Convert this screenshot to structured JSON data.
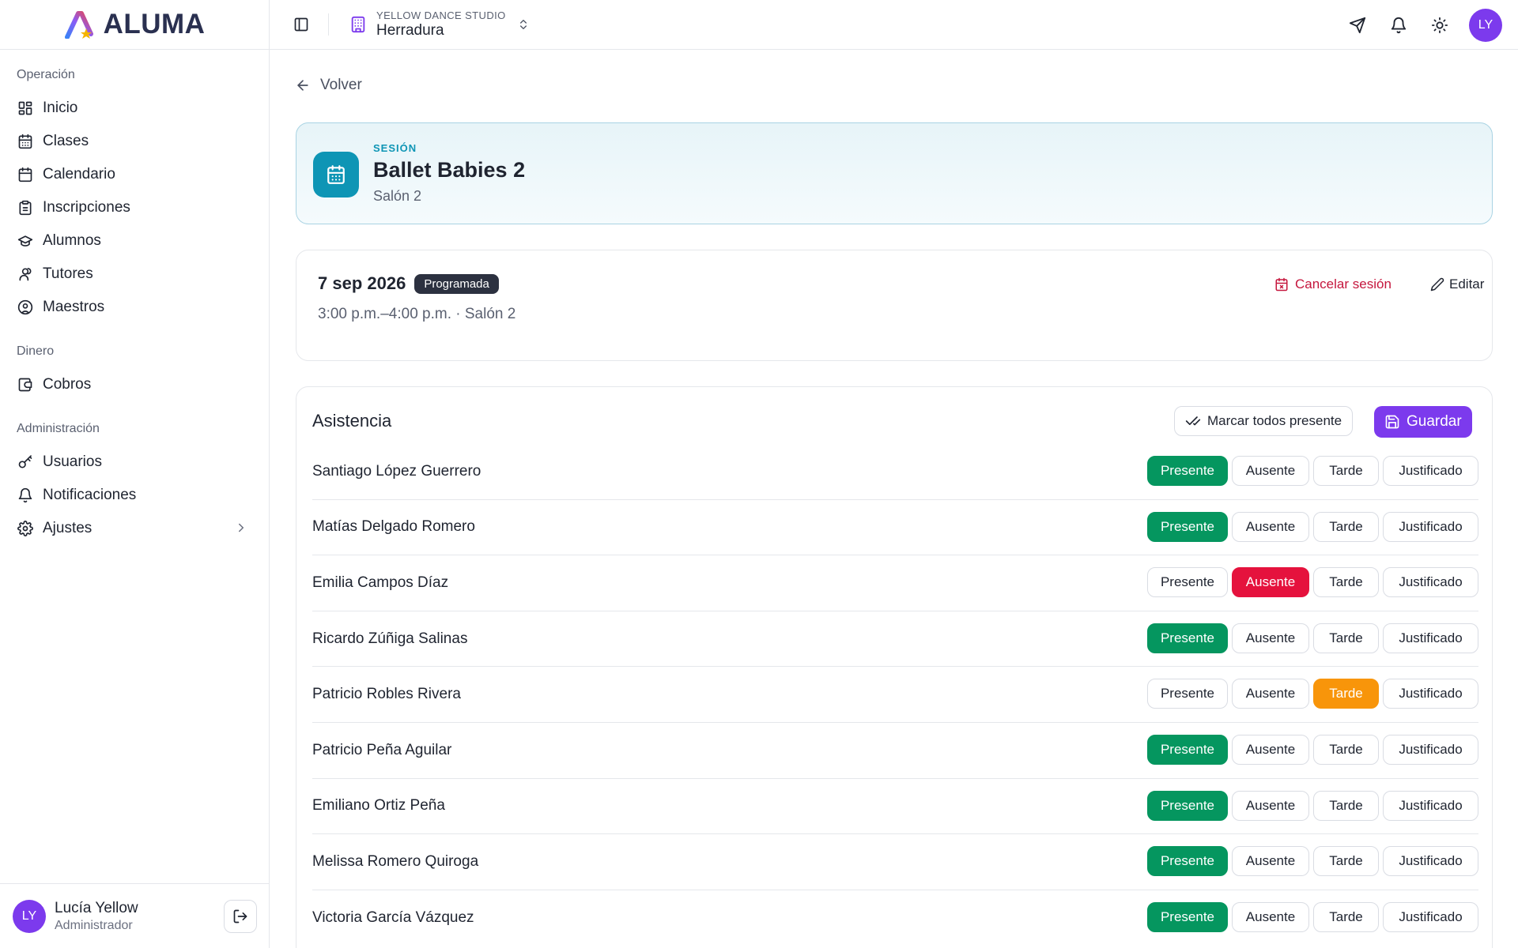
{
  "app": {
    "name": "ALUMA"
  },
  "sidebar": {
    "sections": [
      {
        "title": "Operación",
        "items": [
          {
            "label": "Inicio",
            "icon": "grid-icon"
          },
          {
            "label": "Clases",
            "icon": "calendar-days-icon"
          },
          {
            "label": "Calendario",
            "icon": "calendar-icon"
          },
          {
            "label": "Inscripciones",
            "icon": "clipboard-icon"
          },
          {
            "label": "Alumnos",
            "icon": "graduation-cap-icon"
          },
          {
            "label": "Tutores",
            "icon": "users-icon"
          },
          {
            "label": "Maestros",
            "icon": "user-circle-icon"
          }
        ]
      },
      {
        "title": "Dinero",
        "items": [
          {
            "label": "Cobros",
            "icon": "wallet-icon"
          }
        ]
      },
      {
        "title": "Administración",
        "items": [
          {
            "label": "Usuarios",
            "icon": "key-icon"
          },
          {
            "label": "Notificaciones",
            "icon": "bell-icon"
          },
          {
            "label": "Ajustes",
            "icon": "gear-icon"
          }
        ]
      }
    ],
    "user": {
      "initials": "LY",
      "name": "Lucía Yellow",
      "role": "Administrador"
    }
  },
  "topbar": {
    "studio_label": "YELLOW DANCE STUDIO",
    "studio_name": "Herradura",
    "avatar_initials": "LY"
  },
  "main": {
    "back_label": "Volver",
    "session": {
      "kicker": "SESIÓN",
      "title": "Ballet Babies 2",
      "room": "Salón 2"
    },
    "occurrence": {
      "date": "7 sep 2026",
      "status": "Programada",
      "time": "3:00 p.m.–4:00 p.m. · Salón 2",
      "cancel_label": "Cancelar sesión",
      "edit_label": "Editar"
    },
    "attendance": {
      "title": "Asistencia",
      "mark_all_label": "Marcar todos presente",
      "save_label": "Guardar",
      "options": [
        "Presente",
        "Ausente",
        "Tarde",
        "Justificado"
      ],
      "students": [
        {
          "name": "Santiago López Guerrero",
          "status": "Presente"
        },
        {
          "name": "Matías Delgado Romero",
          "status": "Presente"
        },
        {
          "name": "Emilia Campos Díaz",
          "status": "Ausente"
        },
        {
          "name": "Ricardo Zúñiga Salinas",
          "status": "Presente"
        },
        {
          "name": "Patricio Robles Rivera",
          "status": "Tarde"
        },
        {
          "name": "Patricio Peña Aguilar",
          "status": "Presente"
        },
        {
          "name": "Emiliano Ortiz Peña",
          "status": "Presente"
        },
        {
          "name": "Melissa Romero Quiroga",
          "status": "Presente"
        },
        {
          "name": "Victoria García Vázquez",
          "status": "Presente"
        }
      ]
    }
  }
}
